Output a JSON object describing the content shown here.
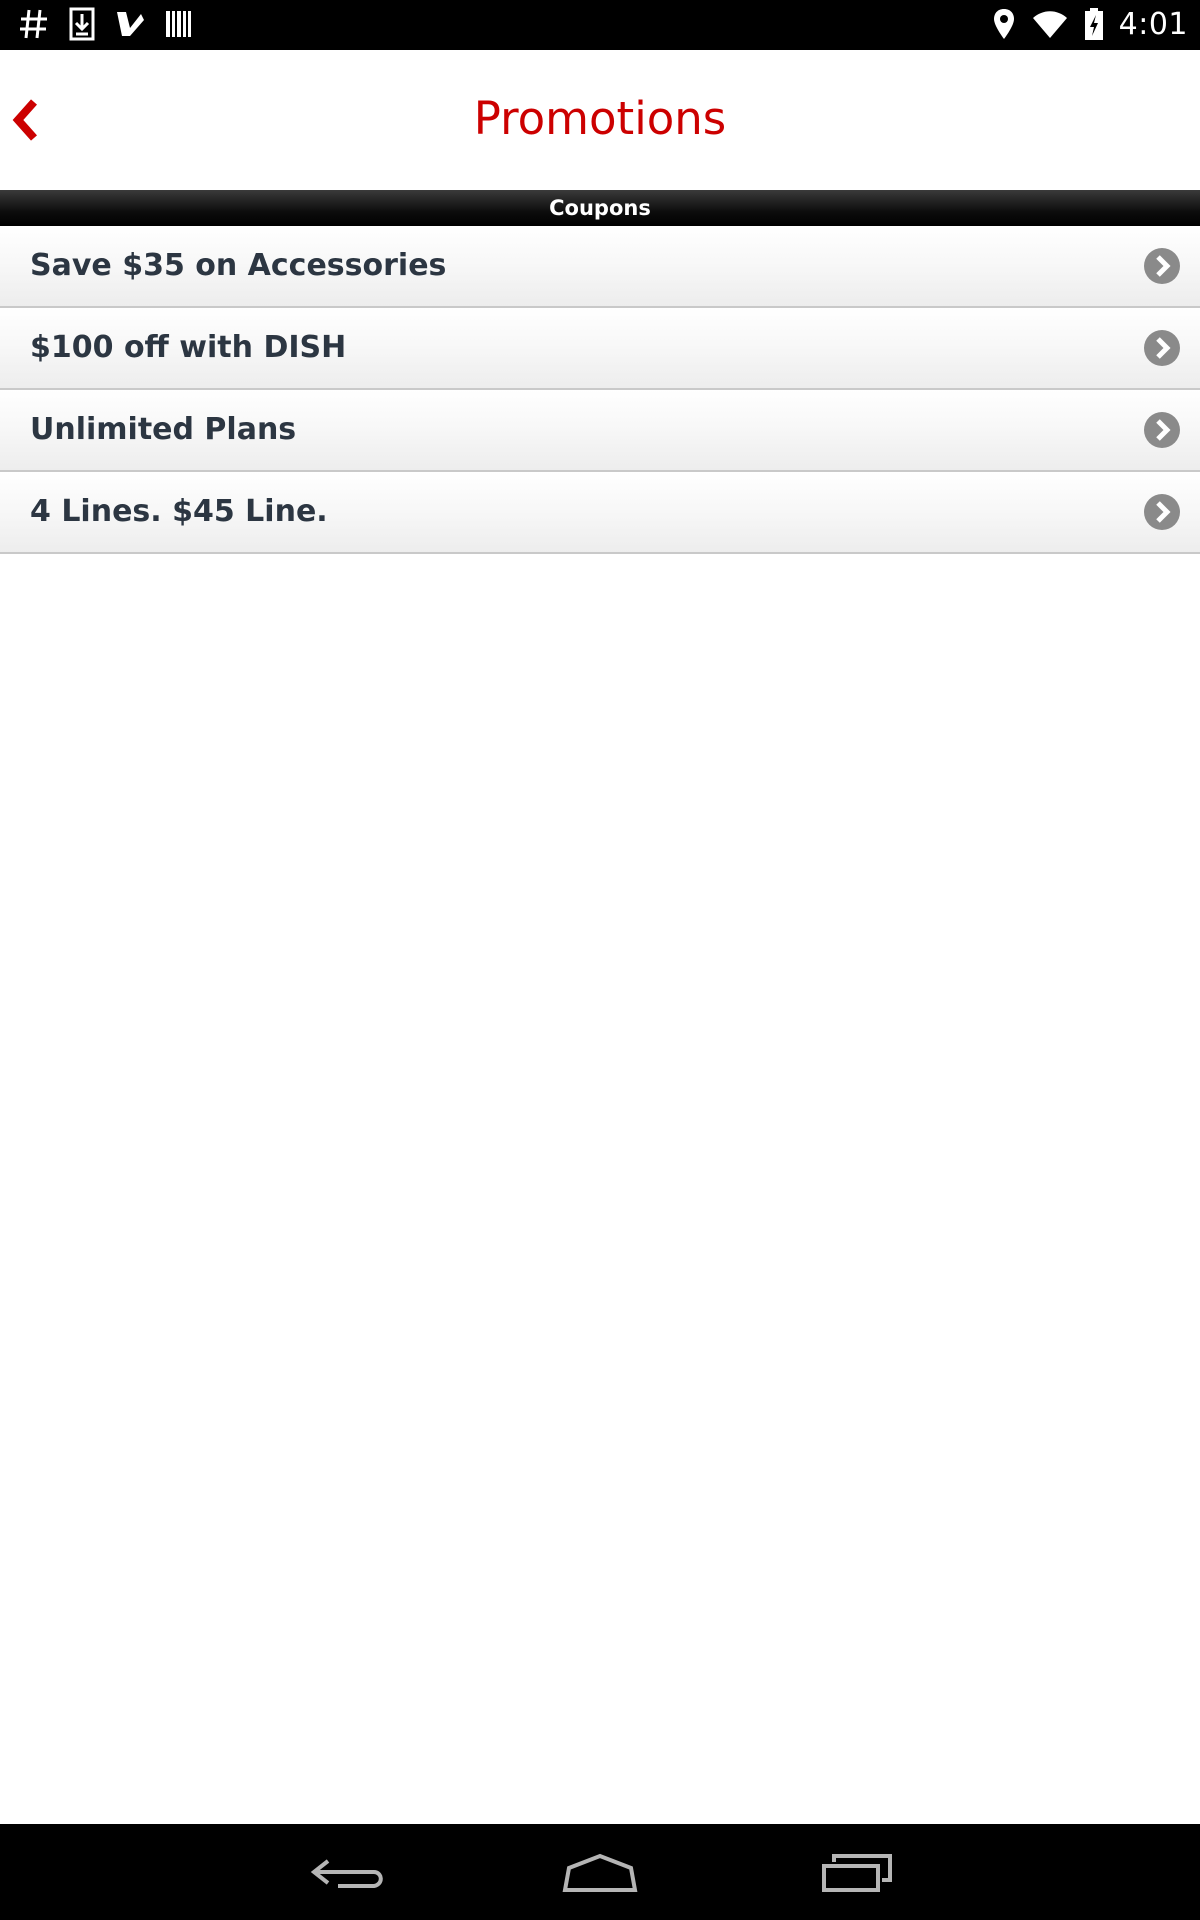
{
  "status_bar": {
    "time": "4:01",
    "icons": [
      "hash-icon",
      "download-icon",
      "checkmark-flag-icon",
      "barcode-icon",
      "location-icon",
      "wifi-icon",
      "battery-charging-icon"
    ]
  },
  "header": {
    "title": "Promotions",
    "back_icon": "chevron-left-icon"
  },
  "section": {
    "title": "Coupons"
  },
  "coupons": [
    {
      "label": "Save $35 on Accessories"
    },
    {
      "label": "$100 off with DISH"
    },
    {
      "label": "Unlimited Plans"
    },
    {
      "label": "4 Lines. $45 Line."
    }
  ],
  "nav_bar": {
    "icons": [
      "back-nav-icon",
      "home-nav-icon",
      "recents-nav-icon"
    ]
  },
  "colors": {
    "accent": "#cc0000",
    "item_text": "#2c3642",
    "chevron_circle": "#8a8a8a"
  }
}
